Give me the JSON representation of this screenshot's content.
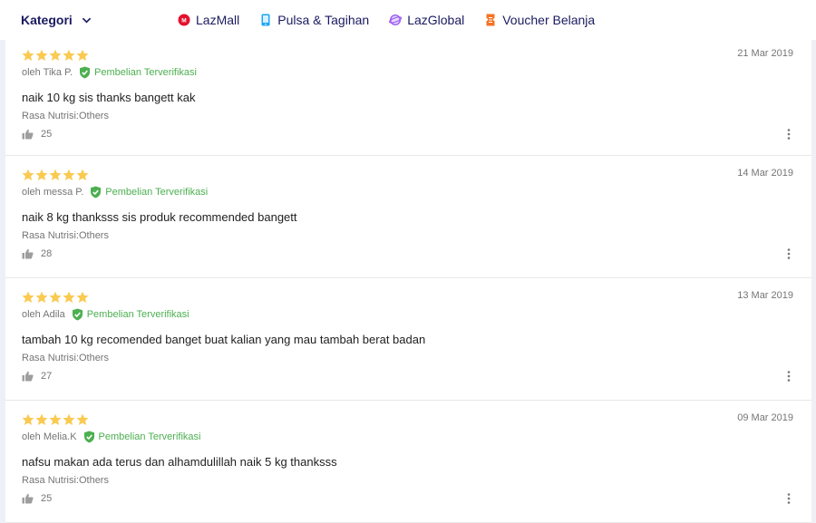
{
  "header": {
    "kategori_label": "Kategori",
    "nav": [
      {
        "label": "LazMall",
        "icon": "lazmall-icon",
        "color": "#e4112d"
      },
      {
        "label": "Pulsa & Tagihan",
        "icon": "phone-icon",
        "color": "#1ba6f4"
      },
      {
        "label": "LazGlobal",
        "icon": "globe-icon",
        "color": "#9c5bf0"
      },
      {
        "label": "Voucher Belanja",
        "icon": "voucher-icon",
        "color": "#f57224"
      }
    ]
  },
  "colors": {
    "star": "#faca51",
    "verified": "#4caf50",
    "nav_text": "#1a1a60"
  },
  "reviews": [
    {
      "rating": 5,
      "date": "21 Mar 2019",
      "author": "oleh Tika P.",
      "verified_label": "Pembelian Terverifikasi",
      "content": "naik 10 kg sis thanks bangett kak",
      "sku": "Rasa Nutrisi:Others",
      "likes": "25"
    },
    {
      "rating": 5,
      "date": "14 Mar 2019",
      "author": "oleh messa P.",
      "verified_label": "Pembelian Terverifikasi",
      "content": "naik 8 kg thanksss sis produk recommended bangett",
      "sku": "Rasa Nutrisi:Others",
      "likes": "28"
    },
    {
      "rating": 5,
      "date": "13 Mar 2019",
      "author": "oleh Adila",
      "verified_label": "Pembelian Terverifikasi",
      "content": "tambah 10 kg recomended banget buat kalian yang mau tambah berat badan",
      "sku": "Rasa Nutrisi:Others",
      "likes": "27"
    },
    {
      "rating": 5,
      "date": "09 Mar 2019",
      "author": "oleh Melia.K",
      "verified_label": "Pembelian Terverifikasi",
      "content": "nafsu makan ada terus dan alhamdulillah naik 5 kg thanksss",
      "sku": "Rasa Nutrisi:Others",
      "likes": "25"
    }
  ]
}
